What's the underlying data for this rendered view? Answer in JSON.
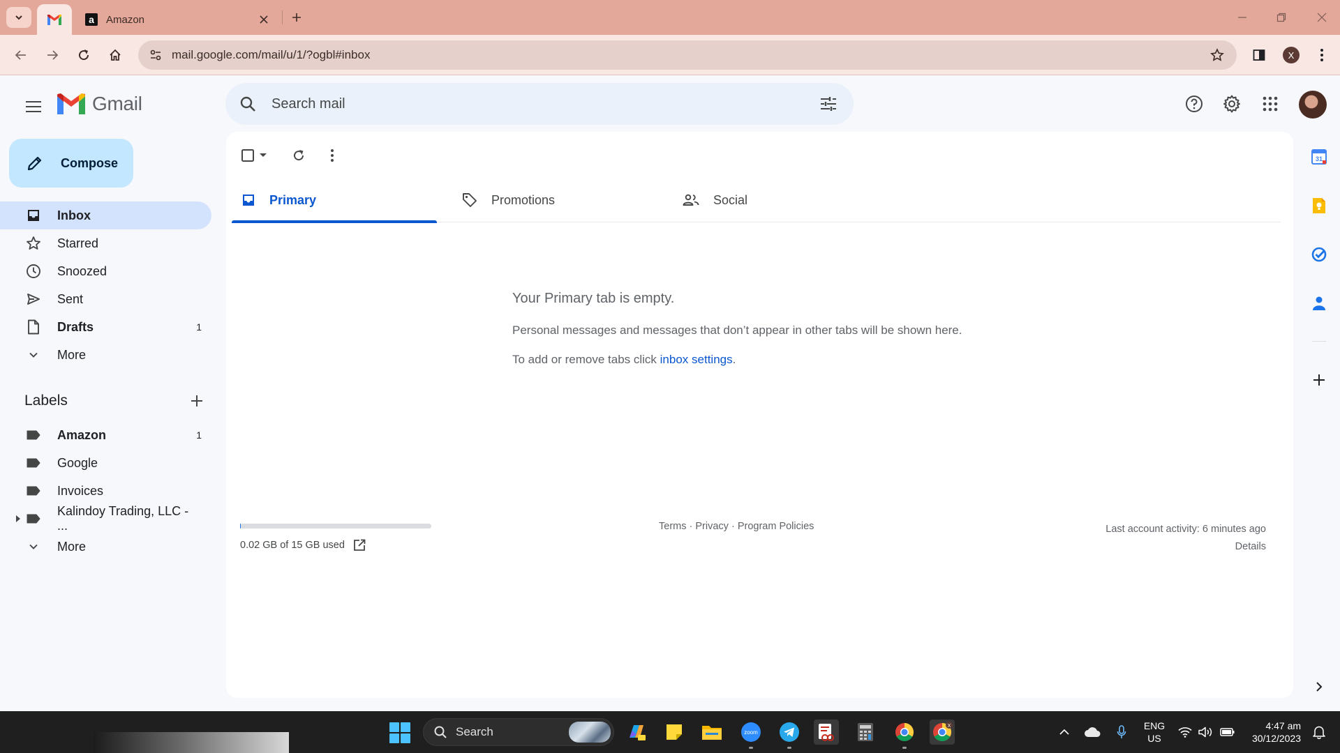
{
  "browser": {
    "tabs": [
      {
        "title": "",
        "icon": "gmail-favicon",
        "active": true
      },
      {
        "title": "Amazon",
        "icon": "amazon-favicon",
        "active": false
      }
    ],
    "url": "mail.google.com/mail/u/1/?ogbl#inbox",
    "profile_initial": "X"
  },
  "gmail": {
    "logo_text": "Gmail",
    "search_placeholder": "Search mail",
    "compose_label": "Compose",
    "nav_items": [
      {
        "label": "Inbox",
        "icon": "inbox-icon",
        "count": "",
        "active": true,
        "bold": true
      },
      {
        "label": "Starred",
        "icon": "star-icon",
        "count": "",
        "active": false,
        "bold": false
      },
      {
        "label": "Snoozed",
        "icon": "clock-icon",
        "count": "",
        "active": false,
        "bold": false
      },
      {
        "label": "Sent",
        "icon": "send-icon",
        "count": "",
        "active": false,
        "bold": false
      },
      {
        "label": "Drafts",
        "icon": "draft-icon",
        "count": "1",
        "active": false,
        "bold": true
      },
      {
        "label": "More",
        "icon": "chevron-down-icon",
        "count": "",
        "active": false,
        "bold": false
      }
    ],
    "labels_title": "Labels",
    "labels": [
      {
        "label": "Amazon",
        "count": "1",
        "bold": true
      },
      {
        "label": "Google",
        "count": "",
        "bold": false
      },
      {
        "label": "Invoices",
        "count": "",
        "bold": false
      },
      {
        "label": "Kalindoy Trading, LLC - ...",
        "count": "",
        "bold": false,
        "expandable": true
      },
      {
        "label": "More",
        "count": "",
        "bold": false
      }
    ],
    "category_tabs": [
      {
        "label": "Primary",
        "icon": "inbox-icon",
        "active": true
      },
      {
        "label": "Promotions",
        "icon": "tag-icon",
        "active": false
      },
      {
        "label": "Social",
        "icon": "people-icon",
        "active": false
      }
    ],
    "empty_state": {
      "title": "Your Primary tab is empty.",
      "text": "Personal messages and messages that don’t appear in other tabs will be shown here.",
      "settings_prefix": "To add or remove tabs click ",
      "settings_link": "inbox settings",
      "settings_suffix": "."
    },
    "footer": {
      "storage_text": "0.02 GB of 15 GB used",
      "storage_fraction": 0.0013,
      "terms": "Terms",
      "privacy": "Privacy",
      "program_policies": "Program Policies",
      "separator": " · ",
      "last_activity": "Last account activity: 6 minutes ago",
      "details": "Details"
    }
  },
  "taskbar": {
    "search_label": "Search",
    "language_line1": "ENG",
    "language_line2": "US",
    "time": "4:47 am",
    "date": "30/12/2023"
  },
  "colors": {
    "accent_blue": "#0b57d0",
    "compose_bg": "#c2e7ff",
    "active_nav_bg": "#d3e3fd",
    "browser_frame": "#e3a899"
  }
}
